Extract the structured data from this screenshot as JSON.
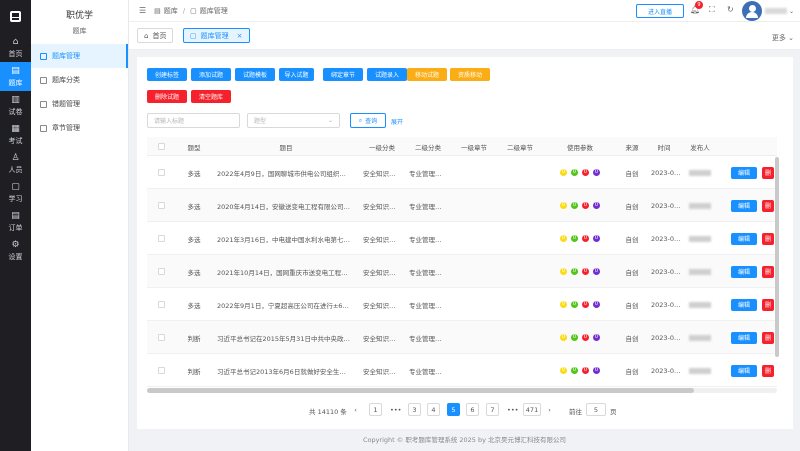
{
  "rail": {
    "items": [
      {
        "label": "首页",
        "icon": "home-icon",
        "glyph": "⌂"
      },
      {
        "label": "题库",
        "icon": "question-bank-icon",
        "glyph": "▤"
      },
      {
        "label": "试卷",
        "icon": "paper-icon",
        "glyph": "▥"
      },
      {
        "label": "考试",
        "icon": "exam-icon",
        "glyph": "▦"
      },
      {
        "label": "人员",
        "icon": "user-icon",
        "glyph": "♙"
      },
      {
        "label": "学习",
        "icon": "study-icon",
        "glyph": "▢"
      },
      {
        "label": "订单",
        "icon": "order-icon",
        "glyph": "▤"
      },
      {
        "label": "设置",
        "icon": "gear-icon",
        "glyph": "⚙"
      }
    ]
  },
  "submenu": {
    "brand": "职优学",
    "section": "题库",
    "items": [
      {
        "label": "题库管理"
      },
      {
        "label": "题库分类"
      },
      {
        "label": "错题管理"
      },
      {
        "label": "章节管理"
      }
    ]
  },
  "topbar": {
    "collapse_glyph": "☰",
    "crumb_1": "题库",
    "crumb_sep": "/",
    "crumb_2": "题库管理",
    "live_button": "进入直播",
    "notify_count": "9",
    "username": "••••••"
  },
  "tabs": {
    "home": "首页",
    "current": "题库管理",
    "close": "×",
    "more": "更多 ⌄"
  },
  "toolbar": {
    "buttons_row1": [
      "创建标签",
      "添加试题",
      "试题模板",
      "导入试题",
      "绑定章节",
      "试题录入",
      "移动试题",
      "资质移动"
    ],
    "buttons_row2": [
      "删除试题",
      "清空题库"
    ]
  },
  "filters": {
    "keyword_placeholder": "请输入标题",
    "type_placeholder": "题型",
    "search_label": "查询",
    "expand_label": "展开"
  },
  "table": {
    "columns": [
      "题型",
      "题目",
      "一级分类",
      "二级分类",
      "一级章节",
      "二级章节",
      "使用参数",
      "来源",
      "时间",
      "发布人"
    ],
    "rows": [
      {
        "type": "多选",
        "title": "2022年4月9日，国网聊城市供电公司组织…",
        "c1": "安全知识…",
        "c2": "专业管理…",
        "source": "自创",
        "time": "2023-0…"
      },
      {
        "type": "多选",
        "title": "2020年4月14日，安徽送变电工程有限公司…",
        "c1": "安全知识…",
        "c2": "专业管理…",
        "source": "自创",
        "time": "2023-0…"
      },
      {
        "type": "多选",
        "title": "2021年3月16日，中电建中国水利水电第七…",
        "c1": "安全知识…",
        "c2": "专业管理…",
        "source": "自创",
        "time": "2023-0…"
      },
      {
        "type": "多选",
        "title": "2021年10月14日，国网重庆市送变电工程…",
        "c1": "安全知识…",
        "c2": "专业管理…",
        "source": "自创",
        "time": "2023-0…"
      },
      {
        "type": "多选",
        "title": "2022年9月1日，宁夏超高压公司在进行±6…",
        "c1": "安全知识…",
        "c2": "专业管理…",
        "source": "自创",
        "time": "2023-0…"
      },
      {
        "type": "判断",
        "title": "习近平总书记在2015年5月31日中共中央政…",
        "c1": "安全知识…",
        "c2": "专业管理…",
        "source": "自创",
        "time": "2023-0…"
      },
      {
        "type": "判断",
        "title": "习近平总书记2013年6月6日就做好安全生…",
        "c1": "安全知识…",
        "c2": "专业管理…",
        "source": "自创",
        "time": "2023-0…"
      }
    ],
    "param_dots": [
      "0",
      "0",
      "0",
      "0"
    ],
    "edit_label": "编辑",
    "delete_label": "删"
  },
  "pagination": {
    "total": "共 14110 条",
    "prev": "‹",
    "next": "›",
    "pages": [
      "1",
      "•••",
      "3",
      "4",
      "5",
      "6",
      "7",
      "•••",
      "471"
    ],
    "current": "5",
    "goto_label": "前往",
    "goto_value": "5",
    "page_unit": "页"
  },
  "footer": "Copyright © 职考题库管理系统 2025 by 北京昊元博汇科技有限公司",
  "colors": {
    "primary": "#1890ff",
    "warning": "#faad14",
    "danger": "#f5222d",
    "dot_yellow": "#fadb14",
    "dot_green": "#52c41a",
    "dot_red": "#f5222d",
    "dot_purple": "#722ed1"
  }
}
